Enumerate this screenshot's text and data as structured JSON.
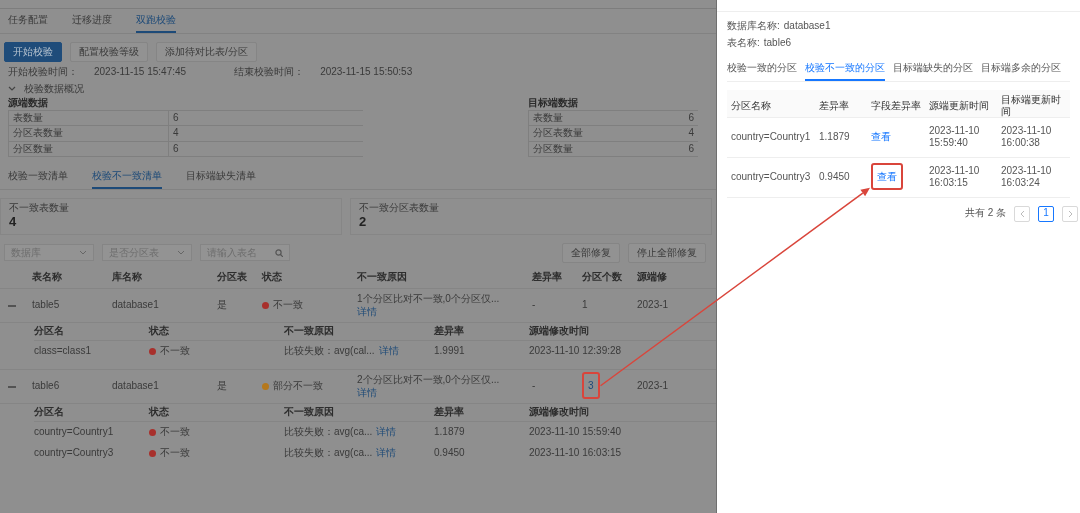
{
  "tabs": [
    {
      "label": "任务配置",
      "selected": false
    },
    {
      "label": "迁移进度",
      "selected": false
    },
    {
      "label": "双跑校验",
      "selected": true
    }
  ],
  "actions": [
    {
      "label": "开始校验",
      "kind": "primary"
    },
    {
      "label": "配置校验等级",
      "kind": "default"
    },
    {
      "label": "添加待对比表/分区",
      "kind": "default"
    }
  ],
  "times": [
    {
      "label": "开始校验时间：",
      "value": "2023-11-15 15:47:45"
    },
    {
      "label": "结束校验时间：",
      "value": "2023-11-15 15:50:53"
    }
  ],
  "overview": {
    "title": "校验数据概况",
    "expanded": true,
    "groups": [
      {
        "title": "源端数据",
        "rows": [
          {
            "label": "表数量",
            "value": "6"
          },
          {
            "label": "分区表数量",
            "value": "4"
          },
          {
            "label": "分区数量",
            "value": "6"
          }
        ]
      },
      {
        "title": "目标端数据",
        "rows": [
          {
            "label": "表数量",
            "value": "6"
          },
          {
            "label": "分区表数量",
            "value": "4"
          },
          {
            "label": "分区数量",
            "value": "6"
          }
        ]
      }
    ]
  },
  "list_tabs": [
    {
      "label": "校验一致清单",
      "selected": false
    },
    {
      "label": "校验不一致清单",
      "selected": true
    },
    {
      "label": "目标端缺失清单",
      "selected": false
    }
  ],
  "stats": [
    {
      "label": "不一致表数量",
      "value": "4"
    },
    {
      "label": "不一致分区表数量",
      "value": "2"
    }
  ],
  "filters": [
    {
      "kind": "select",
      "placeholder": "数据库"
    },
    {
      "kind": "select",
      "placeholder": "是否分区表"
    },
    {
      "kind": "search",
      "placeholder": "请输入表名"
    }
  ],
  "bulk_actions": [
    "全部修复",
    "停止全部修复"
  ],
  "table": {
    "columns": [
      "表名称",
      "库名称",
      "分区表",
      "状态",
      "不一致原因",
      "差异率",
      "分区个数",
      "源端修"
    ],
    "rows": [
      {
        "expanded": true,
        "name": "table5",
        "database": "database1",
        "partitioned": "是",
        "status": {
          "text": "不一致",
          "color": "#a8302c"
        },
        "reason": "1个分区比对不一致,0个分区仅...",
        "detail": "详情",
        "diff": "-",
        "partition_count": "1",
        "count_is_link": false,
        "highlighted": false,
        "modified": "2023-1",
        "partitions": {
          "columns": [
            "分区名",
            "状态",
            "不一致原因",
            "差异率",
            "源端修改时间"
          ],
          "rows": [
            {
              "name": "class=class1",
              "status": {
                "text": "不一致",
                "color": "#a8302c"
              },
              "reason": "比较失败：avg(cal...",
              "detail": "详情",
              "diff": "1.9991",
              "modified": "2023-11-10 12:39:28"
            }
          ]
        }
      },
      {
        "expanded": true,
        "name": "table6",
        "database": "database1",
        "partitioned": "是",
        "status": {
          "text": "部分不一致",
          "color": "#b5781c"
        },
        "reason": "2个分区比对不一致,0个分区仅...",
        "detail": "详情",
        "diff": "-",
        "partition_count": "3",
        "count_is_link": true,
        "highlighted": true,
        "modified": "2023-1",
        "partitions": {
          "columns": [
            "分区名",
            "状态",
            "不一致原因",
            "差异率",
            "源端修改时间"
          ],
          "rows": [
            {
              "name": "country=Country1",
              "status": {
                "text": "不一致",
                "color": "#a8302c"
              },
              "reason": "比较失败：avg(ca...",
              "detail": "详情",
              "diff": "1.1879",
              "modified": "2023-11-10 15:59:40"
            },
            {
              "name": "country=Country3",
              "status": {
                "text": "不一致",
                "color": "#a8302c"
              },
              "reason": "比较失败：avg(ca...",
              "detail": "详情",
              "diff": "0.9450",
              "modified": "2023-11-10 16:03:15"
            }
          ]
        }
      }
    ]
  },
  "drawer": {
    "info": [
      {
        "label": "数据库名称:",
        "value": "database1"
      },
      {
        "label": "表名称:",
        "value": "table6"
      }
    ],
    "tabs": [
      {
        "label": "校验一致的分区",
        "selected": false
      },
      {
        "label": "校验不一致的分区",
        "selected": true
      },
      {
        "label": "目标端缺失的分区",
        "selected": false
      },
      {
        "label": "目标端多余的分区",
        "selected": false
      }
    ],
    "table": {
      "columns": [
        "分区名称",
        "差异率",
        "字段差异率",
        "源端更新时间",
        "目标端更新时间"
      ],
      "rows": [
        {
          "name": "country=Country1",
          "diff": "1.1879",
          "field_diff": "查看",
          "highlighted": false,
          "source_time": "2023-11-10 15:59:40",
          "target_time": "2023-11-10 16:00:38"
        },
        {
          "name": "country=Country3",
          "diff": "0.9450",
          "field_diff": "查看",
          "highlighted": true,
          "source_time": "2023-11-10 16:03:15",
          "target_time": "2023-11-10 16:03:24"
        }
      ]
    },
    "pagination": {
      "total": "共有 2 条",
      "pages": [
        {
          "label": "1",
          "selected": true
        }
      ]
    }
  }
}
